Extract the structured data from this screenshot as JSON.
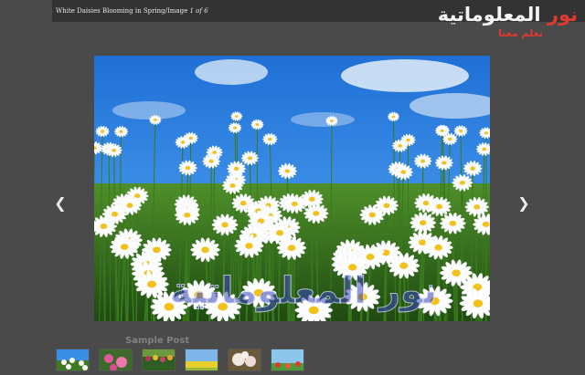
{
  "caption": {
    "title": "White Daisies Blooming in Spring",
    "prefix": "Image",
    "current": "1",
    "of": "of",
    "total": "6"
  },
  "brand": {
    "name_part1": "نور",
    "name_part2": "المعلوماتية",
    "tagline": "تعلم معنا"
  },
  "slideshow": {
    "prev_icon": "chevron-left-icon",
    "next_icon": "chevron-right-icon"
  },
  "watermark": {
    "text": "نور المعلوماتية"
  },
  "post": {
    "title": "Sample Post"
  },
  "thumbnails": [
    "daisies",
    "pink-flowers",
    "tulips",
    "yellow-field",
    "blossoms",
    "poppies"
  ],
  "colors": {
    "accent": "#e03a2e",
    "background": "#4a4a4a",
    "bar": "#333333"
  }
}
